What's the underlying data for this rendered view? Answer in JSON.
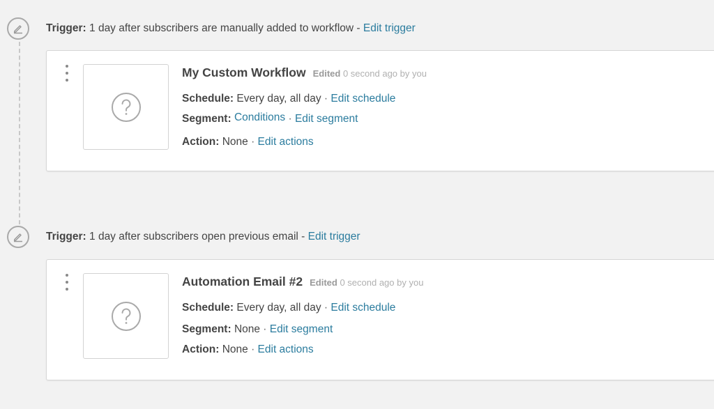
{
  "workflow": [
    {
      "trigger": {
        "label": "Trigger:",
        "text": "1 day after subscribers are manually added to workflow - ",
        "edit_link": "Edit trigger"
      },
      "card": {
        "title": "My Custom Workflow",
        "edited_label": "Edited",
        "edited_meta": "0 second ago by you",
        "schedule": {
          "label": "Schedule:",
          "value": "Every day, all day",
          "edit_link": "Edit schedule"
        },
        "segment": {
          "label": "Segment:",
          "value": "Conditions",
          "value_is_link": true,
          "edit_link": "Edit segment"
        },
        "action": {
          "label": "Action:",
          "value": "None",
          "edit_link": "Edit actions"
        }
      }
    },
    {
      "trigger": {
        "label": "Trigger:",
        "text": "1 day after subscribers open previous email - ",
        "edit_link": "Edit trigger"
      },
      "card": {
        "title": "Automation Email #2",
        "edited_label": "Edited",
        "edited_meta": "0 second ago by you",
        "schedule": {
          "label": "Schedule:",
          "value": "Every day, all day",
          "edit_link": "Edit schedule"
        },
        "segment": {
          "label": "Segment:",
          "value": "None",
          "value_is_link": false,
          "edit_link": "Edit segment"
        },
        "action": {
          "label": "Action:",
          "value": "None",
          "edit_link": "Edit actions"
        }
      }
    }
  ],
  "separator": " · ",
  "icons": {
    "trigger": "pencil-icon",
    "menu": "kebab-menu-icon",
    "thumbnail": "question-mark-icon"
  },
  "colors": {
    "link": "#2b7c9e",
    "background": "#f2f2f2",
    "card": "#ffffff"
  }
}
